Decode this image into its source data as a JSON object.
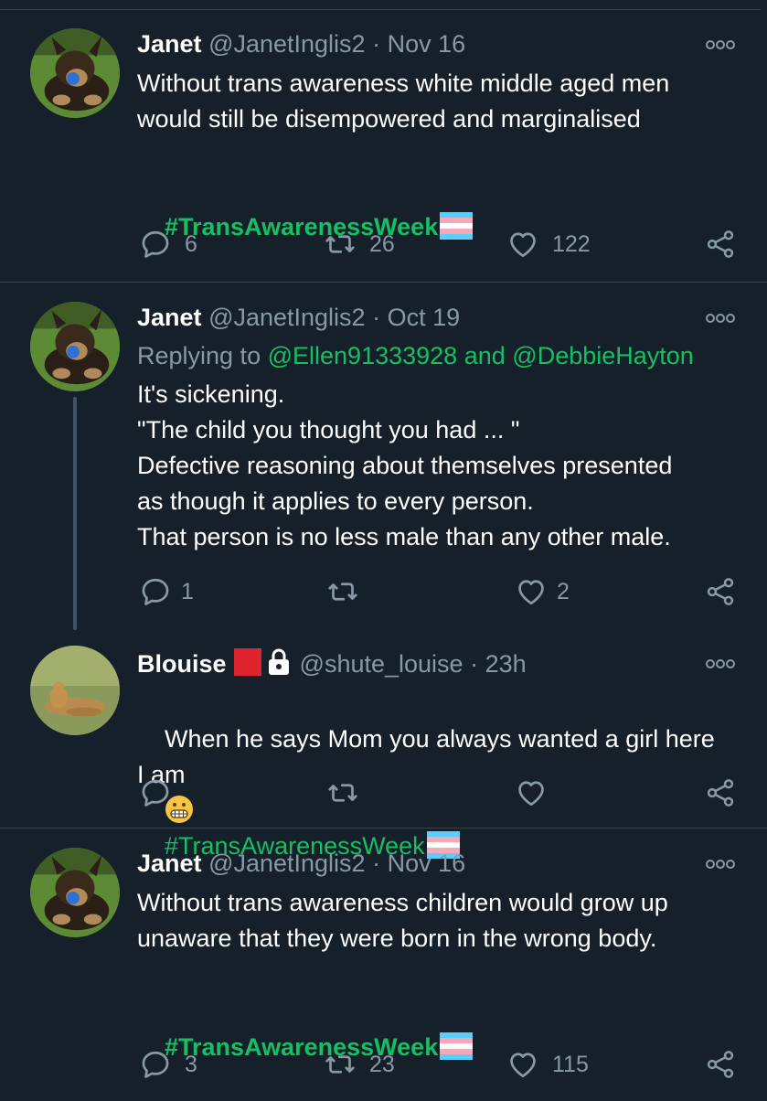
{
  "tweets": [
    {
      "name": "Janet",
      "handle": "@JanetInglis2",
      "sep": "·",
      "date": "Nov 16",
      "text": "Without trans awareness white middle aged men\nwould still be disempowered and marginalised",
      "hashtag": "#TransAwarenessWeek",
      "replies": "6",
      "retweets": "26",
      "likes": "122"
    },
    {
      "name": "Janet",
      "handle": "@JanetInglis2",
      "sep": "·",
      "date": "Oct 19",
      "replying_prefix": "Replying to",
      "replying_user1": "@Ellen91333928",
      "replying_and": "and",
      "replying_user2": "@DebbieHayton",
      "text": "It's sickening.\n\"The child you thought you had ... \"\nDefective reasoning about themselves presented\nas though it applies to every person.\nThat person is no less male than any other male.",
      "replies": "1",
      "retweets": "",
      "likes": "2"
    },
    {
      "name": "Blouise",
      "handle": "@shute_louise",
      "sep": "·",
      "date": "23h",
      "text_line1": "When he says Mom you always wanted a girl here",
      "text_line2": "I am",
      "hashtag": "#TransAwarenessWeek",
      "replies": "",
      "retweets": "",
      "likes": ""
    },
    {
      "name": "Janet",
      "handle": "@JanetInglis2",
      "sep": "·",
      "date": "Nov 16",
      "text": "Without trans awareness children would grow up\nunaware that they were born in the wrong body.",
      "hashtag": "#TransAwarenessWeek",
      "replies": "3",
      "retweets": "23",
      "likes": "115"
    }
  ],
  "icons": {
    "reply": "reply-icon",
    "retweet": "retweet-icon",
    "like": "heart-icon",
    "share": "share-icon",
    "more": "more-options-icon"
  },
  "colors": {
    "background": "#15202b",
    "secondary_text": "#8899a6",
    "accent_link": "#17bf63",
    "divider": "#38444d"
  }
}
